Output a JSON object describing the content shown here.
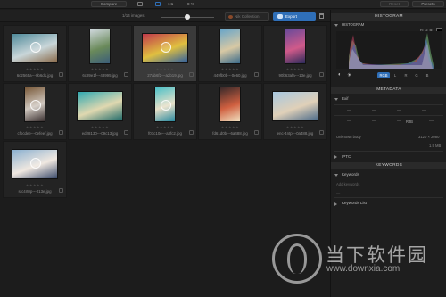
{
  "toolbar": {
    "compare_label": "Compare",
    "zoom_ratio": "1:1",
    "zoom_percent": "8 %",
    "reset_label": "Reset",
    "presets_label": "Presets"
  },
  "browser": {
    "image_count": "1/14 images",
    "thumb_size_fraction": 0.5,
    "collection_label": "Nik Collection",
    "export_label": "Export"
  },
  "thumbnails": [
    {
      "file": "6c2565a---0b6d1.jpg",
      "selected": false,
      "colors": [
        "#4f8a9a",
        "#c9d6d9",
        "#8a6a4a"
      ]
    },
    {
      "file": "6c89e1f---48995.jpg",
      "selected": false,
      "colors": [
        "#cfd8dc",
        "#6a8a5a",
        "#3b5d7a"
      ]
    },
    {
      "file": "27ab6f2---a2b19.jpg",
      "selected": true,
      "colors": [
        "#c0394b",
        "#e0c040",
        "#2f5fa0"
      ]
    },
    {
      "file": "449fb0b---0e60.jpg",
      "selected": false,
      "colors": [
        "#6aa6c9",
        "#d7c8a4",
        "#3a6a8a"
      ]
    },
    {
      "file": "90b63afa---13e.jpg",
      "selected": false,
      "colors": [
        "#6a4a9a",
        "#d05a8a",
        "#2a2a5a"
      ]
    },
    {
      "file": "cfbcdee---0efeef.jpg",
      "selected": false,
      "colors": [
        "#7a5a3a",
        "#d0c8c0",
        "#3a3030"
      ]
    },
    {
      "file": "ed28130---09c13.jpg",
      "selected": false,
      "colors": [
        "#2fa8b0",
        "#e0d8b0",
        "#1f6a6a"
      ]
    },
    {
      "file": "f07c10e---a3fc2.jpg",
      "selected": false,
      "colors": [
        "#4ac0c8",
        "#e8e0c8",
        "#2a8aa0"
      ]
    },
    {
      "file": "fd61d0b---6a488.jpg",
      "selected": false,
      "colors": [
        "#3a2a2a",
        "#d06040",
        "#f0e0c0"
      ]
    },
    {
      "file": "enc-4ntp---0a488.jpg",
      "selected": false,
      "colors": [
        "#a8c8e0",
        "#e0d0b8",
        "#4a6a8a"
      ]
    },
    {
      "file": "src4rt0p---013e.jpg",
      "selected": false,
      "colors": [
        "#8ab0d0",
        "#f0e8e0",
        "#3a4a6a"
      ]
    }
  ],
  "panel": {
    "histogram_title": "HISTOGRAM",
    "rgb_readout": "R: G: B:",
    "hist_buttons": [
      "RGB",
      "L",
      "R",
      "G",
      "B"
    ],
    "metadata_title": "METADATA",
    "exif_label": "Exif",
    "exif_tag": "RJB",
    "camera": "Unknown body",
    "dimensions": "3120 × 2080",
    "filesize": "1.9 MB",
    "iptc_label": "IPTC",
    "keywords_title": "KEYWORDS",
    "keywords_label": "Keywords",
    "keywords_placeholder": "Add keywords",
    "keywords_list_label": "Keywords List"
  },
  "watermark": {
    "text": "当下软件园",
    "url": "www.downxia.com"
  }
}
